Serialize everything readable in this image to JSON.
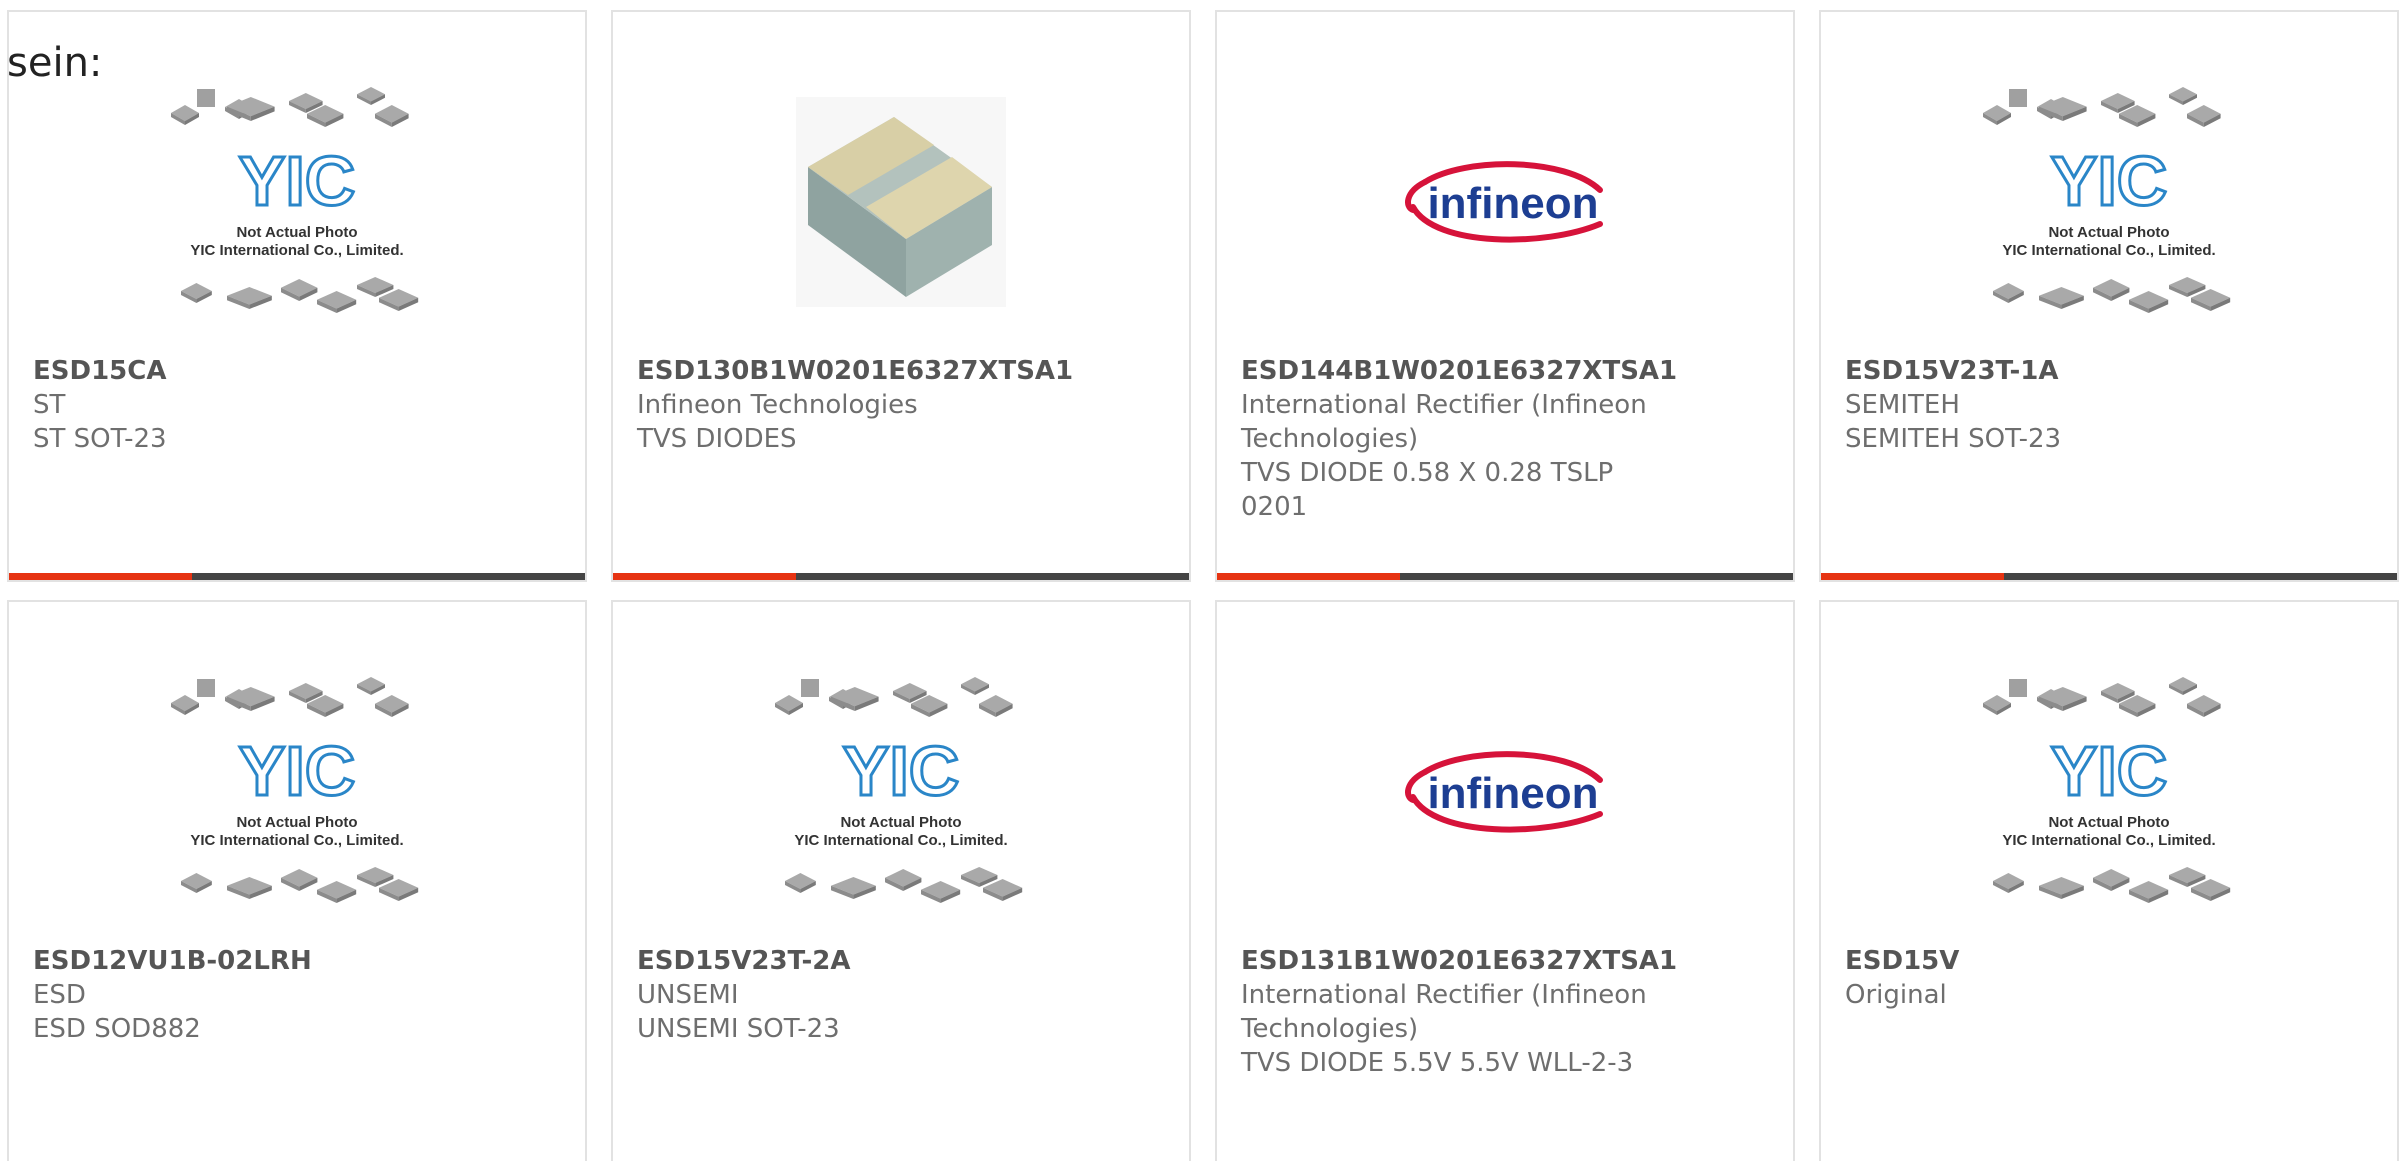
{
  "intro_text": "sein:",
  "placeholder": {
    "brand": "YIC",
    "line1": "Not Actual Photo",
    "line2": "YIC International Co., Limited."
  },
  "infineon_logo_text": "infineon",
  "colors": {
    "accent_red": "#e63312",
    "accent_dark": "#444444",
    "yic_blue": "#2a86c8",
    "infineon_red": "#d6133a",
    "infineon_blue": "#1d3e92"
  },
  "products": [
    {
      "part": "ESD15CA",
      "lines": [
        "ST",
        "ST SOT-23"
      ],
      "image": "not-actual-photo"
    },
    {
      "part": "ESD130B1W0201E6327XTSA1",
      "lines": [
        "Infineon Technologies",
        "TVS DIODES"
      ],
      "image": "chip-component"
    },
    {
      "part": "ESD144B1W0201E6327XTSA1",
      "lines": [
        "International Rectifier (Infineon",
        "Technologies)",
        "TVS DIODE 0.58 X 0.28 TSLP",
        "0201"
      ],
      "image": "infineon-logo"
    },
    {
      "part": "ESD15V23T-1A",
      "lines": [
        "SEMITEH",
        "SEMITEH SOT-23"
      ],
      "image": "not-actual-photo"
    },
    {
      "part": "ESD12VU1B-02LRH",
      "lines": [
        "ESD",
        "ESD SOD882"
      ],
      "image": "not-actual-photo"
    },
    {
      "part": "ESD15V23T-2A",
      "lines": [
        "UNSEMI",
        "UNSEMI SOT-23"
      ],
      "image": "not-actual-photo"
    },
    {
      "part": "ESD131B1W0201E6327XTSA1",
      "lines": [
        "International Rectifier (Infineon",
        "Technologies)",
        "TVS DIODE 5.5V 5.5V WLL-2-3"
      ],
      "image": "infineon-logo"
    },
    {
      "part": "ESD15V",
      "lines": [
        "Original"
      ],
      "image": "not-actual-photo"
    }
  ]
}
